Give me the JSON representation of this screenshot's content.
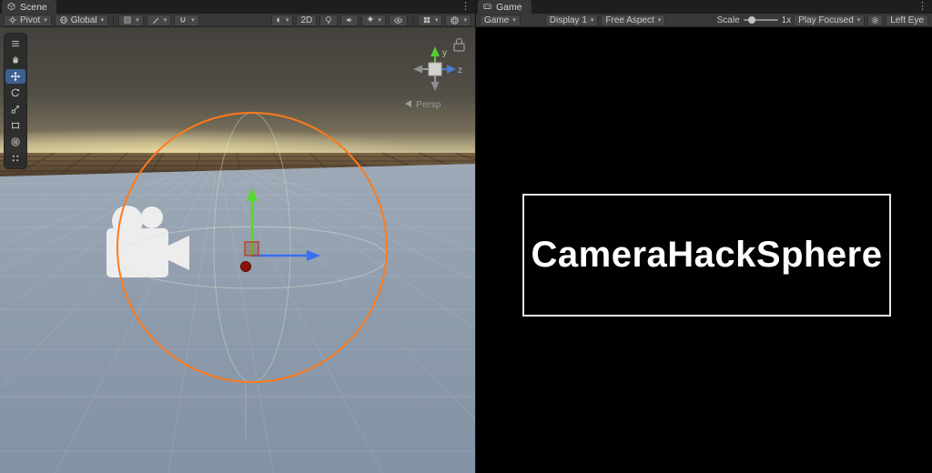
{
  "scene": {
    "tab_label": "Scene",
    "toolbar": {
      "pivot_label": "Pivot",
      "global_label": "Global",
      "mode_2d_label": "2D"
    },
    "viewport": {
      "persp_label": "Persp",
      "axis_y_label": "y",
      "axis_z_label": "z"
    }
  },
  "game": {
    "tab_label": "Game",
    "toolbar": {
      "game_menu_label": "Game",
      "display_label": "Display 1",
      "aspect_label": "Free Aspect",
      "scale_label": "Scale",
      "scale_value": "1x",
      "play_focused_label": "Play Focused",
      "left_eye_label": "Left Eye"
    },
    "screen_text": "CameraHackSphere"
  },
  "icons": {
    "kebab": "⋮",
    "dropdown": "▾",
    "shaded_mode": "◐",
    "effects_star": "✦"
  },
  "colors": {
    "selection_orange": "#ff7a1a",
    "axis_green": "#58d52c",
    "axis_blue": "#3a6ff2",
    "gizmo_red": "#8b1408"
  }
}
